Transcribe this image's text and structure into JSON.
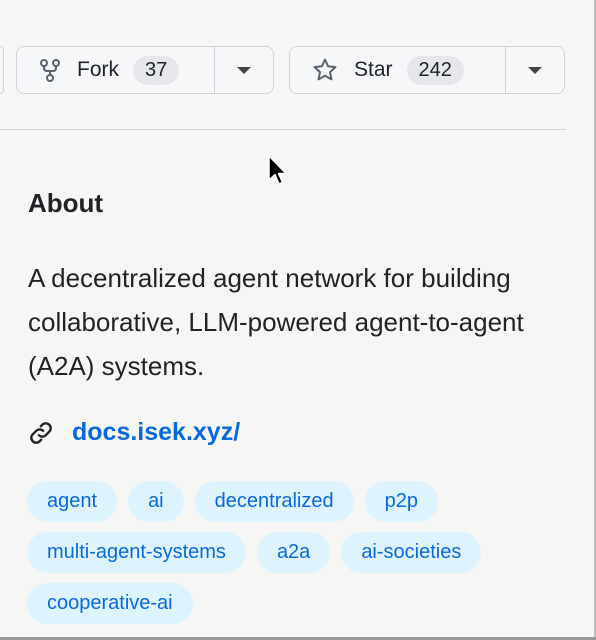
{
  "actions": {
    "fork": {
      "label": "Fork",
      "count": "37"
    },
    "star": {
      "label": "Star",
      "count": "242"
    }
  },
  "about": {
    "title": "About",
    "description": "A decentralized agent network for building collaborative, LLM-powered agent-to-agent (A2A) systems.",
    "website": "docs.isek.xyz/"
  },
  "topics": [
    "agent",
    "ai",
    "decentralized",
    "p2p",
    "multi-agent-systems",
    "a2a",
    "ai-societies",
    "cooperative-ai"
  ],
  "colors": {
    "link": "#0969da",
    "topic_bg": "#ddf4ff"
  },
  "icons": [
    "fork-icon",
    "star-icon",
    "link-icon",
    "chevron-down-icon",
    "mouse-cursor-icon"
  ]
}
